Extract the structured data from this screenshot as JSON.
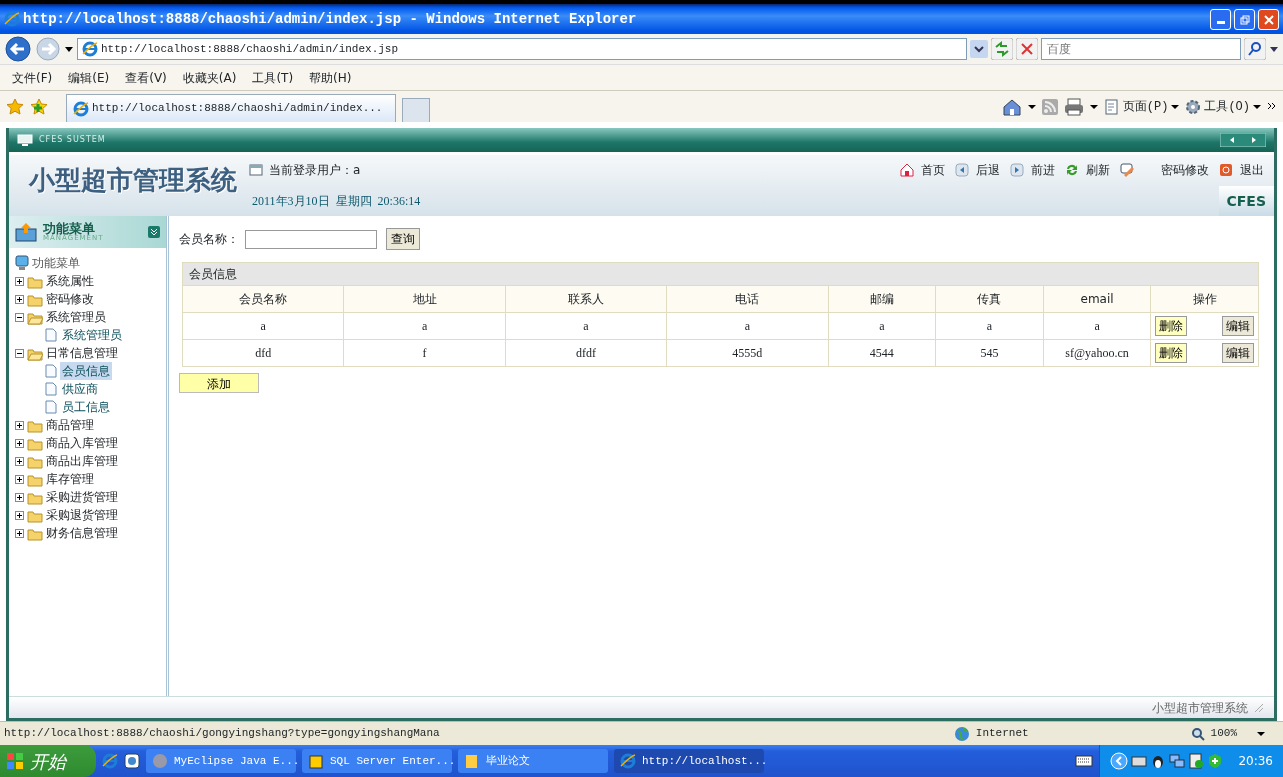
{
  "window": {
    "title": "http://localhost:8888/chaoshi/admin/index.jsp - Windows Internet Explorer"
  },
  "address": "http://localhost:8888/chaoshi/admin/index.jsp",
  "search": {
    "placeholder": "百度"
  },
  "menu": [
    "文件(F)",
    "编辑(E)",
    "查看(V)",
    "收藏夹(A)",
    "工具(T)",
    "帮助(H)"
  ],
  "tab": {
    "title": "http://localhost:8888/chaoshi/admin/index..."
  },
  "commands": [
    "页面(P)",
    "工具(O)"
  ],
  "app": {
    "frame_title": "CFES SUSTEM",
    "system_title": "小型超市管理系统",
    "current_user": "当前登录用户：a",
    "datetime": "2011年3月10日  星期四  20:36:14",
    "brand": "CFES",
    "nav": [
      {
        "kind": "home",
        "label": "首页"
      },
      {
        "kind": "back",
        "label": "后退"
      },
      {
        "kind": "forward",
        "label": "前进"
      },
      {
        "kind": "refresh",
        "label": "刷新"
      },
      {
        "kind": "password",
        "label": "密码修改"
      },
      {
        "kind": "exit",
        "label": "退出"
      }
    ],
    "sidebar": {
      "title": "功能菜单",
      "subtitle": "MANAGEMENT",
      "root": "功能菜单",
      "items": [
        {
          "label": "系统属性",
          "expanded": false
        },
        {
          "label": "密码修改",
          "expanded": false
        },
        {
          "label": "系统管理员",
          "expanded": true,
          "children": [
            {
              "label": "系统管理员",
              "selected": false
            }
          ]
        },
        {
          "label": "日常信息管理",
          "expanded": true,
          "children": [
            {
              "label": "会员信息",
              "selected": true
            },
            {
              "label": "供应商",
              "selected": false
            },
            {
              "label": "员工信息",
              "selected": false
            }
          ]
        },
        {
          "label": "商品管理",
          "expanded": false
        },
        {
          "label": "商品入库管理",
          "expanded": false
        },
        {
          "label": "商品出库管理",
          "expanded": false
        },
        {
          "label": "库存管理",
          "expanded": false
        },
        {
          "label": "采购进货管理",
          "expanded": false
        },
        {
          "label": "采购退货管理",
          "expanded": false
        },
        {
          "label": "财务信息管理",
          "expanded": false
        }
      ]
    },
    "filter": {
      "label": "会员名称：",
      "button": "查询"
    },
    "table": {
      "title": "会员信息",
      "columns": [
        "会员名称",
        "地址",
        "联系人",
        "电话",
        "邮编",
        "传真",
        "email",
        "操作"
      ],
      "rows": [
        {
          "cells": [
            "a",
            "a",
            "a",
            "a",
            "a",
            "a",
            "a"
          ],
          "actions": [
            "删除",
            "编辑"
          ]
        },
        {
          "cells": [
            "dfd",
            "f",
            "dfdf",
            "4555d",
            "4544",
            "545",
            "sf@yahoo.cn"
          ],
          "actions": [
            "删除",
            "编辑"
          ]
        }
      ]
    },
    "add_button": "添加",
    "footer": "小型超市管理系统"
  },
  "status_bar": {
    "url": "http://localhost:8888/chaoshi/gongyingshang?type=gongyingshangMana",
    "zone": "Internet",
    "zoom": "100%"
  },
  "taskbar": {
    "start": "开始",
    "tasks": [
      {
        "label": "MyEclipse Java E...",
        "selected": false
      },
      {
        "label": "SQL Server Enter...",
        "selected": false
      },
      {
        "label": "毕业论文",
        "selected": false
      },
      {
        "label": "http://localhost...",
        "selected": true
      }
    ],
    "clock": "20:36"
  }
}
